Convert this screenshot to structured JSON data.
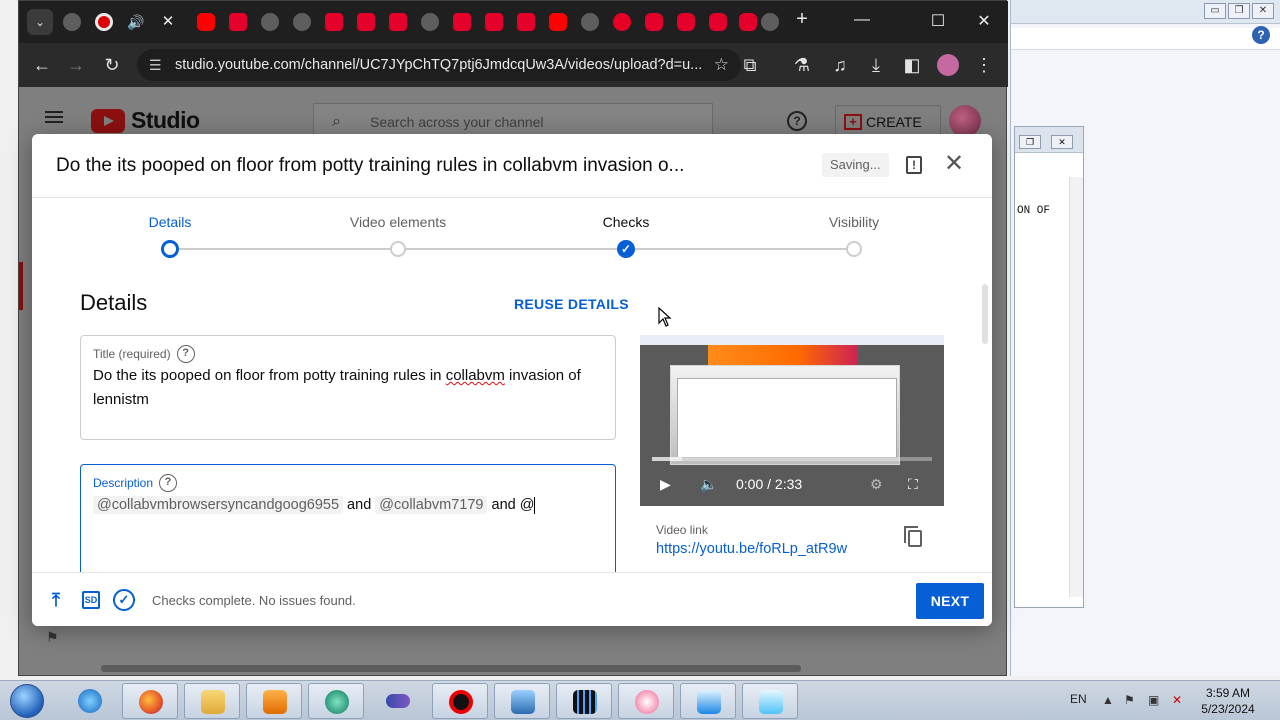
{
  "browser": {
    "url": "studio.youtube.com/channel/UC7JYpChTQ7ptj6JmdcqUw3A/videos/upload?d=u..."
  },
  "studio": {
    "logo_text": "Studio",
    "search_placeholder": "Search across your channel",
    "create_label": "CREATE"
  },
  "modal": {
    "title": "Do the its pooped on floor from potty training rules in collabvm invasion o...",
    "saving": "Saving...",
    "steps": [
      "Details",
      "Video elements",
      "Checks",
      "Visibility"
    ],
    "section_title": "Details",
    "reuse_label": "REUSE DETAILS",
    "title_field": {
      "label": "Title (required)",
      "value_part1": "Do the its pooped on floor from potty training rules in ",
      "value_misspelled": "collabvm",
      "value_part2": " invasion of lennistm"
    },
    "description_field": {
      "label": "Description",
      "mention1": "@collabvmbrowsersyncandgoog6955",
      "and1": " and ",
      "mention2": "@collabvm7179",
      "and2": " and @"
    },
    "preview": {
      "time": "0:00 / 2:33",
      "link_label": "Video link",
      "link": "https://youtu.be/foRLp_atR9w"
    },
    "footer": {
      "status": "Checks complete. No issues found.",
      "next_label": "NEXT",
      "sd_badge": "SD"
    }
  },
  "background_window": {
    "text": "ON OF"
  },
  "taskbar": {
    "language": "EN",
    "time": "3:59 AM",
    "date": "5/23/2024"
  },
  "colors": {
    "accent": "#065fd4",
    "youtube_red": "#ff0000",
    "chrome_dark": "#1f1f1f"
  }
}
